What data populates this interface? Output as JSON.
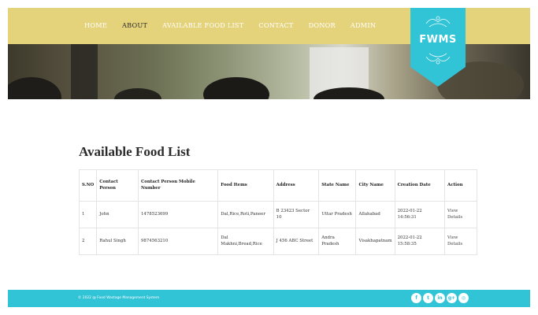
{
  "nav": {
    "items": [
      {
        "label": "HOME",
        "active": false
      },
      {
        "label": "ABOUT",
        "active": true
      },
      {
        "label": "AVAILABLE FOOD LIST",
        "active": false
      },
      {
        "label": "CONTACT",
        "active": false
      },
      {
        "label": "DONOR",
        "active": false
      },
      {
        "label": "ADMIN",
        "active": false
      }
    ]
  },
  "logo": {
    "text": "FWMS",
    "color": "#31c3d6"
  },
  "main": {
    "title": "Available Food List"
  },
  "table": {
    "headers": [
      "S.NO",
      "Contact Person",
      "Contact Person Mobile Number",
      "Food Items",
      "Address",
      "State Name",
      "City Name",
      "Creation Date",
      "Action"
    ],
    "rows": [
      [
        "1",
        "John",
        "1478523699",
        "Dal,Rice,Roti,Paneer",
        "B 23423 Sector 10",
        "Uttar Pradesh",
        "Allahabad",
        "2022-01-22 14:56:31",
        "View Details"
      ],
      [
        "2",
        "Rahul Singh",
        "9874563210",
        "Dal Makhni,Bread,Rice",
        "J 456 ABC Street",
        "Andra Pradesh",
        "Visakhapatnam",
        "2022-01-22 15:58:35",
        "View Details"
      ]
    ]
  },
  "footer": {
    "copyright": "© 2022 @ Food Wastage Management System",
    "social": [
      {
        "icon": "facebook-icon",
        "glyph": "f"
      },
      {
        "icon": "twitter-icon",
        "glyph": "t"
      },
      {
        "icon": "linkedin-icon",
        "glyph": "in"
      },
      {
        "icon": "google-plus-icon",
        "glyph": "g+"
      },
      {
        "icon": "instagram-icon",
        "glyph": "◎"
      }
    ]
  },
  "colors": {
    "nav_bg": "#e5d37c",
    "footer_bg": "#31c3d6",
    "accent": "#31c3d6"
  }
}
